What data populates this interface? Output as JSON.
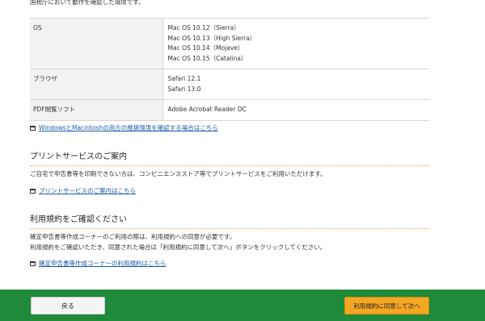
{
  "intro_text": "国税庁において動作を確認した環境です。",
  "environment_table": {
    "rows": [
      {
        "label": "OS",
        "values": [
          "Mac OS 10.12（Sierra）",
          "Mac OS 10.13（High Sierra）",
          "Mac OS 10.14（Mojave）",
          "Mac OS 10.15（Catalina）"
        ]
      },
      {
        "label": "ブラウザ",
        "values": [
          "Safari 12.1",
          "Safari 13.0"
        ]
      },
      {
        "label": "PDF閲覧ソフト",
        "values": [
          "Adobe Acrobat Reader DC"
        ]
      }
    ]
  },
  "links": {
    "recommended_env": "WindowsとMacintoshの両方の推奨環境を確認する場合はこちら",
    "print_service": "プリントサービスのご案内はこちら",
    "terms": "確定申告書等作成コーナーの利用規約はこちら"
  },
  "print_section": {
    "title": "プリントサービスのご案内",
    "text": "ご自宅で申告書等を印刷できない方は、コンビニエンスストア等でプリントサービスをご利用いただけます。"
  },
  "terms_section": {
    "title": "利用規約をご確認ください",
    "line1": "確定申告書等作成コーナーのご利用の際は、利用規約への同意が必要です。",
    "line2": "利用規約をご確認いただき、同意された場合は「利用規約に同意して次へ」ボタンをクリックしてください。"
  },
  "footer": {
    "back_label": "戻る",
    "agree_label": "利用規約に同意して次へ"
  },
  "colors": {
    "footer_bg": "#1e8a3a",
    "agree_button": "#f5a623",
    "link": "#1a5aa6",
    "section_rule": "#f0a028"
  },
  "icons": {
    "external_window": "window-icon"
  }
}
